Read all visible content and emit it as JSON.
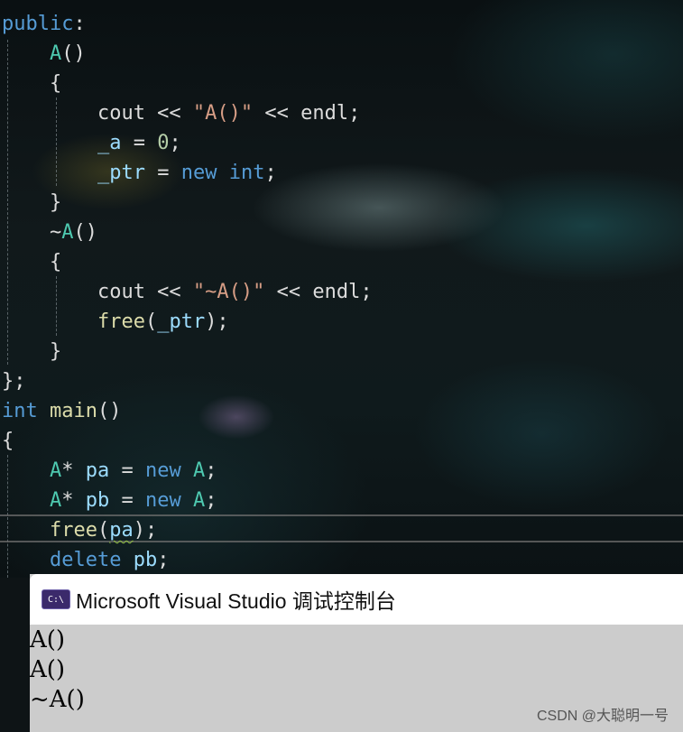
{
  "editor": {
    "lines": [
      [
        {
          "t": "public",
          "c": "kw"
        },
        {
          "t": ":",
          "c": "txt"
        }
      ],
      [
        {
          "t": "    ",
          "c": "txt"
        },
        {
          "t": "A",
          "c": "type"
        },
        {
          "t": "()",
          "c": "txt"
        }
      ],
      [
        {
          "t": "    {",
          "c": "txt"
        }
      ],
      [
        {
          "t": "        cout << ",
          "c": "txt"
        },
        {
          "t": "\"A()\"",
          "c": "str"
        },
        {
          "t": " << endl;",
          "c": "txt"
        }
      ],
      [
        {
          "t": "        ",
          "c": "txt"
        },
        {
          "t": "_a",
          "c": "var"
        },
        {
          "t": " = ",
          "c": "txt"
        },
        {
          "t": "0",
          "c": "num"
        },
        {
          "t": ";",
          "c": "txt"
        }
      ],
      [
        {
          "t": "        ",
          "c": "txt"
        },
        {
          "t": "_ptr",
          "c": "var"
        },
        {
          "t": " = ",
          "c": "txt"
        },
        {
          "t": "new",
          "c": "kw"
        },
        {
          "t": " ",
          "c": "txt"
        },
        {
          "t": "int",
          "c": "kw"
        },
        {
          "t": ";",
          "c": "txt"
        }
      ],
      [
        {
          "t": "    }",
          "c": "txt"
        }
      ],
      [
        {
          "t": "    ~",
          "c": "txt"
        },
        {
          "t": "A",
          "c": "type"
        },
        {
          "t": "()",
          "c": "txt"
        }
      ],
      [
        {
          "t": "    {",
          "c": "txt"
        }
      ],
      [
        {
          "t": "        cout << ",
          "c": "txt"
        },
        {
          "t": "\"~A()\"",
          "c": "str"
        },
        {
          "t": " << endl;",
          "c": "txt"
        }
      ],
      [
        {
          "t": "        ",
          "c": "txt"
        },
        {
          "t": "free",
          "c": "fn"
        },
        {
          "t": "(",
          "c": "txt"
        },
        {
          "t": "_ptr",
          "c": "var"
        },
        {
          "t": ");",
          "c": "txt"
        }
      ],
      [
        {
          "t": "    }",
          "c": "txt"
        }
      ],
      [
        {
          "t": "};",
          "c": "txt"
        }
      ],
      [
        {
          "t": "int",
          "c": "kw"
        },
        {
          "t": " ",
          "c": "txt"
        },
        {
          "t": "main",
          "c": "fn"
        },
        {
          "t": "()",
          "c": "txt"
        }
      ],
      [
        {
          "t": "{",
          "c": "txt"
        }
      ],
      [
        {
          "t": "    ",
          "c": "txt"
        },
        {
          "t": "A",
          "c": "type"
        },
        {
          "t": "* ",
          "c": "txt"
        },
        {
          "t": "pa",
          "c": "var"
        },
        {
          "t": " = ",
          "c": "txt"
        },
        {
          "t": "new",
          "c": "kw"
        },
        {
          "t": " ",
          "c": "txt"
        },
        {
          "t": "A",
          "c": "type"
        },
        {
          "t": ";",
          "c": "txt"
        }
      ],
      [
        {
          "t": "    ",
          "c": "txt"
        },
        {
          "t": "A",
          "c": "type"
        },
        {
          "t": "* ",
          "c": "txt"
        },
        {
          "t": "pb",
          "c": "var"
        },
        {
          "t": " = ",
          "c": "txt"
        },
        {
          "t": "new",
          "c": "kw"
        },
        {
          "t": " ",
          "c": "txt"
        },
        {
          "t": "A",
          "c": "type"
        },
        {
          "t": ";",
          "c": "txt"
        }
      ],
      [
        {
          "t": "    ",
          "c": "txt"
        },
        {
          "t": "free",
          "c": "fn"
        },
        {
          "t": "(",
          "c": "txt"
        },
        {
          "t": "pa",
          "c": "var",
          "squiggle": true
        },
        {
          "t": ");",
          "c": "txt"
        }
      ],
      [
        {
          "t": "    ",
          "c": "txt"
        },
        {
          "t": "delete",
          "c": "kw"
        },
        {
          "t": " ",
          "c": "txt"
        },
        {
          "t": "pb",
          "c": "var"
        },
        {
          "t": ";",
          "c": "txt"
        }
      ]
    ]
  },
  "console": {
    "icon_text": "C:\\",
    "title": "Microsoft Visual Studio 调试控制台",
    "output": [
      "A()",
      "A()",
      "~A()"
    ]
  },
  "watermark": "CSDN @大聪明一号",
  "colors": {
    "keyword": "#569cd6",
    "type": "#4ec9b0",
    "function": "#dcdcaa",
    "string": "#d69d85",
    "number": "#b5cea8",
    "variable": "#9cdcfe",
    "text": "#dcdcdc",
    "console_bg": "#cccccc"
  }
}
